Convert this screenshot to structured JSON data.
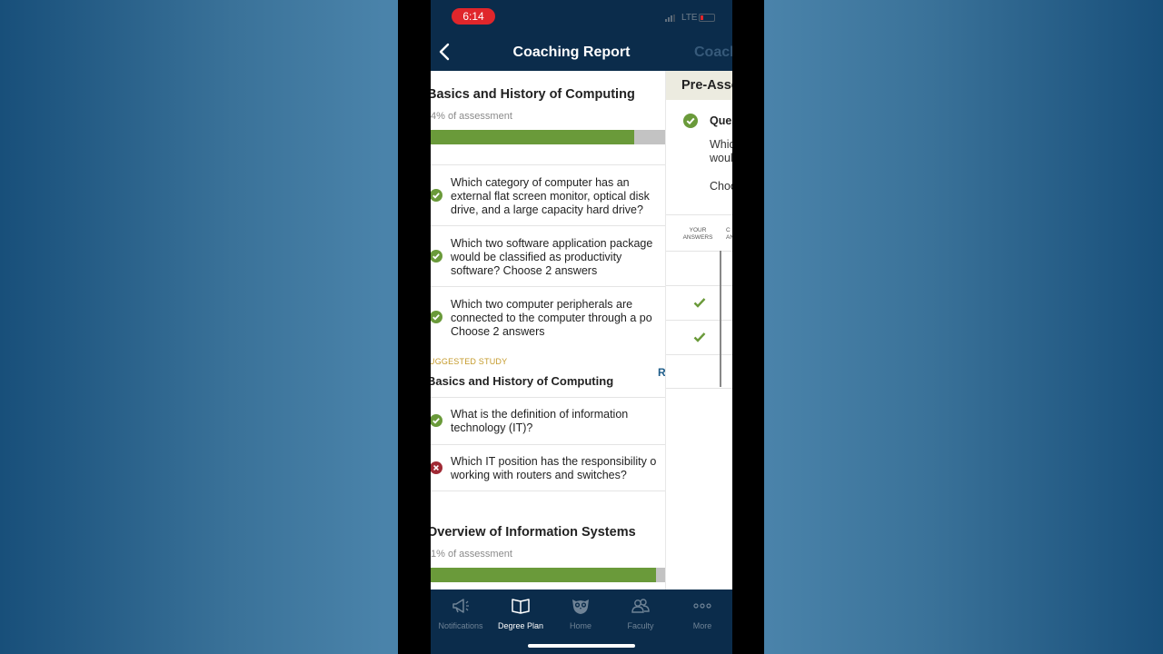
{
  "status_bar": {
    "time": "6:14",
    "network": "LTE"
  },
  "nav": {
    "title": "Coaching Report",
    "next_title": "Coach"
  },
  "sections": [
    {
      "title": "Basics and History of Computing",
      "percent_text": "4% of assessment",
      "progress_fraction": 0.87
    },
    {
      "title": "Overview of Information Systems",
      "percent_text": "1% of assessment",
      "progress_fraction": 0.96
    }
  ],
  "questions_group1": [
    {
      "lines": [
        "Which category of computer has an",
        "external flat screen monitor, optical disk",
        "drive, and a large capacity hard drive?"
      ],
      "status": "correct"
    },
    {
      "lines": [
        "Which two software application package",
        "would be classified as productivity",
        "software?  Choose 2 answers"
      ],
      "status": "correct"
    },
    {
      "lines": [
        "Which two computer peripherals are",
        "connected to the computer through a po",
        "Choose 2 answers"
      ],
      "status": "correct"
    }
  ],
  "suggested": {
    "label": "UGGESTED STUDY",
    "title": "Basics and History of Computing",
    "review_link": "R"
  },
  "questions_group2": [
    {
      "lines": [
        "What is the definition of information",
        "technology (IT)?"
      ],
      "status": "correct"
    },
    {
      "lines": [
        "Which IT position has the responsibility o",
        "working with routers and switches?"
      ],
      "status": "incorrect"
    }
  ],
  "right_panel": {
    "header": "Pre-Asse",
    "question_label": "Ques",
    "text_lines": [
      "Whic",
      "woul"
    ],
    "choose_text": "Choo",
    "col_your": [
      "YOUR",
      "ANSWERS"
    ],
    "col_correct": [
      "C",
      "AN"
    ]
  },
  "tabs": [
    {
      "label": "Notifications",
      "icon": "megaphone-icon",
      "active": false
    },
    {
      "label": "Degree Plan",
      "icon": "book-icon",
      "active": true
    },
    {
      "label": "Home",
      "icon": "owl-icon",
      "active": false
    },
    {
      "label": "Faculty",
      "icon": "people-icon",
      "active": false
    },
    {
      "label": "More",
      "icon": "more-dots-icon",
      "active": false
    }
  ],
  "colors": {
    "nav_bg": "#0b2c4b",
    "progress_fill": "#6a9a3a",
    "correct": "#6a9a3a",
    "incorrect": "#a02a35",
    "suggested": "#c49a2a"
  }
}
